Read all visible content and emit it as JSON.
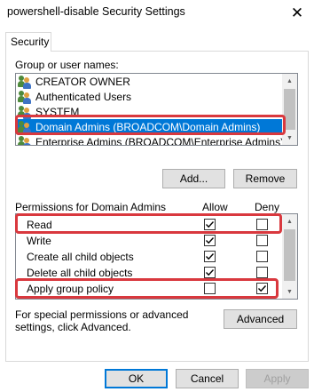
{
  "window": {
    "title": "powershell-disable Security Settings",
    "close_glyph": "✕"
  },
  "tabs": [
    {
      "label": "Security",
      "active": true
    }
  ],
  "group_section": {
    "label": "Group or user names:",
    "items": [
      {
        "name": "CREATOR OWNER",
        "icon": "user-group-icon",
        "selected": false
      },
      {
        "name": "Authenticated Users",
        "icon": "user-group-icon",
        "selected": false
      },
      {
        "name": "SYSTEM",
        "icon": "user-group-icon",
        "selected": false
      },
      {
        "name": "Domain Admins (BROADCOM\\Domain Admins)",
        "icon": "user-group-icon",
        "selected": true
      },
      {
        "name": "Enterprise Admins (BROADCOM\\Enterprise Admins)",
        "icon": "user-group-icon",
        "selected": false
      }
    ]
  },
  "group_buttons": {
    "add_label": "Add...",
    "remove_label": "Remove"
  },
  "permissions": {
    "header_label": "Permissions for Domain Admins",
    "allow_label": "Allow",
    "deny_label": "Deny",
    "rows": [
      {
        "label": "Read",
        "allow": true,
        "deny": false,
        "highlighted": true
      },
      {
        "label": "Write",
        "allow": true,
        "deny": false,
        "highlighted": false
      },
      {
        "label": "Create all child objects",
        "allow": true,
        "deny": false,
        "highlighted": false
      },
      {
        "label": "Delete all child objects",
        "allow": true,
        "deny": false,
        "highlighted": false
      },
      {
        "label": "Apply group policy",
        "allow": false,
        "deny": true,
        "highlighted": true
      }
    ]
  },
  "advanced": {
    "text": "For special permissions or advanced settings, click Advanced.",
    "button_label": "Advanced"
  },
  "footer": {
    "ok_label": "OK",
    "cancel_label": "Cancel",
    "apply_label": "Apply"
  },
  "colors": {
    "selection": "#0078d7",
    "highlight_box": "#d9383e",
    "button_bg": "#e1e1e1"
  }
}
